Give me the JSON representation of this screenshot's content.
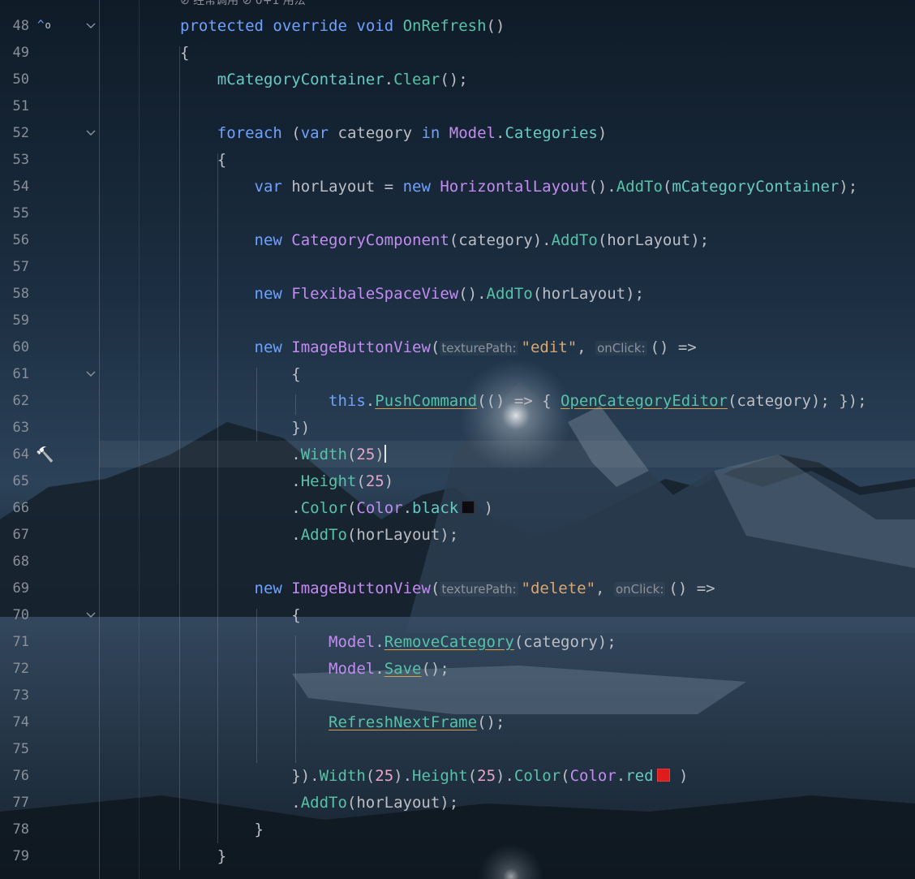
{
  "editor": {
    "top_hint": "⊘ 经常调用  ⊘ 0+1 用法",
    "colors": {
      "keyword": "#6fa1ff",
      "type": "#c28cf0",
      "method": "#57c2a7",
      "string": "#d9a872",
      "number": "#e7a6c8",
      "black_swatch": "#0b0b10",
      "red_swatch": "#e01b1b"
    },
    "lines": [
      {
        "n": "48",
        "tokens": [
          [
            "kw",
            "protected"
          ],
          [
            "pa",
            " "
          ],
          [
            "kw",
            "override"
          ],
          [
            "pa",
            " "
          ],
          [
            "kw",
            "void"
          ],
          [
            "pa",
            " "
          ],
          [
            "me",
            "OnRefresh"
          ],
          [
            "pa",
            "()"
          ]
        ]
      },
      {
        "n": "49",
        "tokens": [
          [
            "pa",
            "{"
          ]
        ]
      },
      {
        "n": "50",
        "tokens": [
          [
            "pa",
            "    "
          ],
          [
            "fd",
            "mCategoryContainer"
          ],
          [
            "pa",
            "."
          ],
          [
            "me",
            "Clear"
          ],
          [
            "pa",
            "();"
          ]
        ]
      },
      {
        "n": "51",
        "tokens": []
      },
      {
        "n": "52",
        "tokens": [
          [
            "pa",
            "    "
          ],
          [
            "kw",
            "foreach"
          ],
          [
            "pa",
            " ("
          ],
          [
            "kw",
            "var"
          ],
          [
            "pa",
            " category "
          ],
          [
            "kw",
            "in"
          ],
          [
            "pa",
            " "
          ],
          [
            "ty",
            "Model"
          ],
          [
            "pa",
            "."
          ],
          [
            "fd",
            "Categories"
          ],
          [
            "pa",
            ")"
          ]
        ]
      },
      {
        "n": "53",
        "tokens": [
          [
            "pa",
            "    {"
          ]
        ]
      },
      {
        "n": "54",
        "tokens": [
          [
            "pa",
            "        "
          ],
          [
            "kw",
            "var"
          ],
          [
            "pa",
            " horLayout = "
          ],
          [
            "kw",
            "new"
          ],
          [
            "pa",
            " "
          ],
          [
            "ty",
            "HorizontalLayout"
          ],
          [
            "pa",
            "()."
          ],
          [
            "me",
            "AddTo"
          ],
          [
            "pa",
            "("
          ],
          [
            "fd",
            "mCategoryContainer"
          ],
          [
            "pa",
            ");"
          ]
        ]
      },
      {
        "n": "55",
        "tokens": []
      },
      {
        "n": "56",
        "tokens": [
          [
            "pa",
            "        "
          ],
          [
            "kw",
            "new"
          ],
          [
            "pa",
            " "
          ],
          [
            "ty",
            "CategoryComponent"
          ],
          [
            "pa",
            "(category)."
          ],
          [
            "me",
            "AddTo"
          ],
          [
            "pa",
            "(horLayout);"
          ]
        ]
      },
      {
        "n": "57",
        "tokens": []
      },
      {
        "n": "58",
        "tokens": [
          [
            "pa",
            "        "
          ],
          [
            "kw",
            "new"
          ],
          [
            "pa",
            " "
          ],
          [
            "ty",
            "FlexibaleSpaceView"
          ],
          [
            "pa",
            "()."
          ],
          [
            "me",
            "AddTo"
          ],
          [
            "pa",
            "(horLayout);"
          ]
        ]
      },
      {
        "n": "59",
        "tokens": []
      },
      {
        "n": "60",
        "tokens": [
          [
            "pa",
            "        "
          ],
          [
            "kw",
            "new"
          ],
          [
            "pa",
            " "
          ],
          [
            "ty",
            "ImageButtonView"
          ],
          [
            "pa",
            "("
          ],
          [
            "hint",
            "texturePath:"
          ],
          [
            "st",
            "\"edit\""
          ],
          [
            "pa",
            ", "
          ],
          [
            "hint",
            "onClick:"
          ],
          [
            "pa",
            "() =>"
          ]
        ]
      },
      {
        "n": "61",
        "tokens": [
          [
            "pa",
            "            {"
          ]
        ]
      },
      {
        "n": "62",
        "tokens": [
          [
            "pa",
            "                "
          ],
          [
            "kw",
            "this"
          ],
          [
            "pa",
            "."
          ],
          [
            "lk",
            "PushCommand"
          ],
          [
            "pa",
            "(() => { "
          ],
          [
            "lk",
            "OpenCategoryEditor"
          ],
          [
            "pa",
            "(category); });"
          ]
        ]
      },
      {
        "n": "63",
        "tokens": [
          [
            "pa",
            "            })"
          ]
        ]
      },
      {
        "n": "64",
        "tokens": [
          [
            "pa",
            "            ."
          ],
          [
            "me",
            "Width"
          ],
          [
            "pa",
            "("
          ],
          [
            "nu",
            "25"
          ],
          [
            "pa",
            ")"
          ],
          [
            "caret",
            ""
          ]
        ]
      },
      {
        "n": "65",
        "tokens": [
          [
            "pa",
            "            ."
          ],
          [
            "me",
            "Height"
          ],
          [
            "pa",
            "("
          ],
          [
            "nu",
            "25"
          ],
          [
            "pa",
            ")"
          ]
        ]
      },
      {
        "n": "66",
        "tokens": [
          [
            "pa",
            "            ."
          ],
          [
            "me",
            "Color"
          ],
          [
            "pa",
            "("
          ],
          [
            "ty",
            "Color"
          ],
          [
            "pa",
            "."
          ],
          [
            "fd",
            "black"
          ],
          [
            "swatch_black",
            ""
          ],
          [
            "pa",
            " )"
          ]
        ]
      },
      {
        "n": "67",
        "tokens": [
          [
            "pa",
            "            ."
          ],
          [
            "me",
            "AddTo"
          ],
          [
            "pa",
            "(horLayout);"
          ]
        ]
      },
      {
        "n": "68",
        "tokens": []
      },
      {
        "n": "69",
        "tokens": [
          [
            "pa",
            "        "
          ],
          [
            "kw",
            "new"
          ],
          [
            "pa",
            " "
          ],
          [
            "ty",
            "ImageButtonView"
          ],
          [
            "pa",
            "("
          ],
          [
            "hint",
            "texturePath:"
          ],
          [
            "st",
            "\"delete\""
          ],
          [
            "pa",
            ", "
          ],
          [
            "hint",
            "onClick:"
          ],
          [
            "pa",
            "() =>"
          ]
        ]
      },
      {
        "n": "70",
        "tokens": [
          [
            "pa",
            "            {"
          ]
        ]
      },
      {
        "n": "71",
        "tokens": [
          [
            "pa",
            "                "
          ],
          [
            "ty",
            "Model"
          ],
          [
            "pa",
            "."
          ],
          [
            "lk",
            "RemoveCategory"
          ],
          [
            "pa",
            "(category);"
          ]
        ]
      },
      {
        "n": "72",
        "tokens": [
          [
            "pa",
            "                "
          ],
          [
            "ty",
            "Model"
          ],
          [
            "pa",
            "."
          ],
          [
            "lk",
            "Save"
          ],
          [
            "pa",
            "();"
          ]
        ]
      },
      {
        "n": "73",
        "tokens": []
      },
      {
        "n": "74",
        "tokens": [
          [
            "pa",
            "                "
          ],
          [
            "lk",
            "RefreshNextFrame"
          ],
          [
            "pa",
            "();"
          ]
        ]
      },
      {
        "n": "75",
        "tokens": []
      },
      {
        "n": "76",
        "tokens": [
          [
            "pa",
            "            })."
          ],
          [
            "me",
            "Width"
          ],
          [
            "pa",
            "("
          ],
          [
            "nu",
            "25"
          ],
          [
            "pa",
            ")."
          ],
          [
            "me",
            "Height"
          ],
          [
            "pa",
            "("
          ],
          [
            "nu",
            "25"
          ],
          [
            "pa",
            ")."
          ],
          [
            "me",
            "Color"
          ],
          [
            "pa",
            "("
          ],
          [
            "ty",
            "Color"
          ],
          [
            "pa",
            "."
          ],
          [
            "fd",
            "red"
          ],
          [
            "swatch_red",
            ""
          ],
          [
            "pa",
            " )"
          ]
        ]
      },
      {
        "n": "77",
        "tokens": [
          [
            "pa",
            "            ."
          ],
          [
            "me",
            "AddTo"
          ],
          [
            "pa",
            "(horLayout);"
          ]
        ]
      },
      {
        "n": "78",
        "tokens": [
          [
            "pa",
            "        }"
          ]
        ]
      },
      {
        "n": "79",
        "tokens": [
          [
            "pa",
            "    }"
          ]
        ]
      }
    ],
    "fold_lines": [
      "48",
      "52",
      "61",
      "70"
    ],
    "override_line": "48",
    "build_line": "64",
    "current_line": "64"
  }
}
